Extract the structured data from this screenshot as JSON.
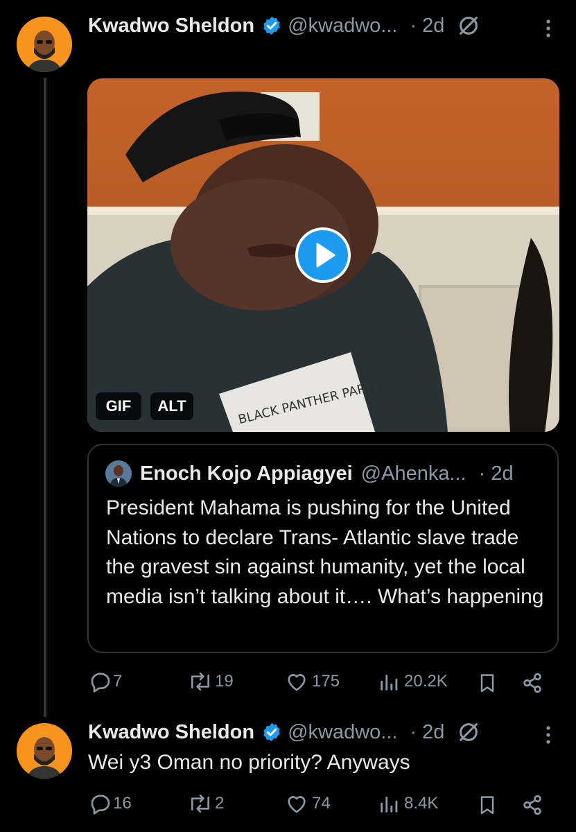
{
  "tweet1": {
    "name": "Kwadwo Sheldon",
    "handle": "@kwadwo...",
    "time": "· 2d",
    "media": {
      "gif_badge": "GIF",
      "alt_badge": "ALT",
      "shirt_text": "BLACK PANTHER PARTY"
    },
    "quote": {
      "name": "Enoch Kojo Appiagyei",
      "handle": "@Ahenka...",
      "time": "· 2d",
      "text": "President Mahama is pushing for the United Nations to declare Trans- Atlantic slave trade the gravest sin against humanity, yet the local media isn’t talking about it…. What’s happening"
    },
    "actions": {
      "replies": "7",
      "reposts": "19",
      "likes": "175",
      "views": "20.2K"
    }
  },
  "tweet2": {
    "name": "Kwadwo Sheldon",
    "handle": "@kwadwo...",
    "time": "· 2d",
    "text": "Wei y3 Oman no priority? Anyways",
    "actions": {
      "replies": "16",
      "reposts": "2",
      "likes": "74",
      "views": "8.4K"
    }
  },
  "colors": {
    "accent": "#1d9bf0",
    "secondary_text": "#8b98a5",
    "avatar_bg": "#f7941d"
  }
}
